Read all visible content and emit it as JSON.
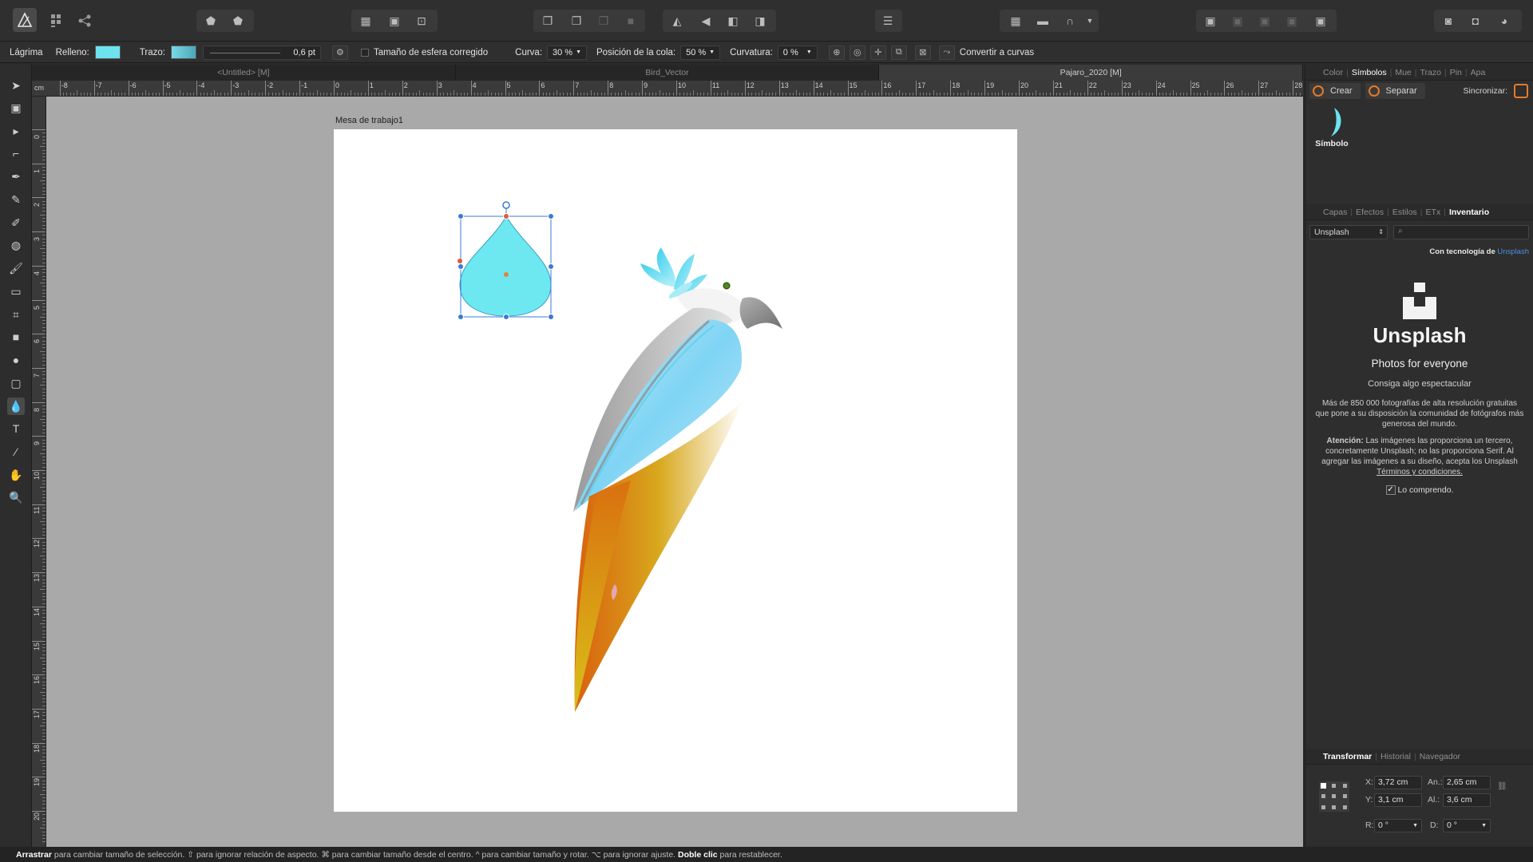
{
  "context_toolbar": {
    "tool_name": "Lágrima",
    "fill_label": "Relleno:",
    "fill_color": "#6de3f0",
    "stroke_label": "Trazo:",
    "stroke_width": "0,6 pt",
    "corrected_size_label": "Tamaño de esfera corregido",
    "curve_label": "Curva:",
    "curve_value": "30 %",
    "tail_label": "Posición de la cola:",
    "tail_value": "50 %",
    "curvature_label": "Curvatura:",
    "curvature_value": "0 %",
    "convert_label": "Convertir a curvas"
  },
  "document_tabs": [
    {
      "label": "<Untitled> [M]",
      "active": false
    },
    {
      "label": "Bird_Vector",
      "active": false
    },
    {
      "label": "Pajaro_2020 [M]",
      "active": true
    }
  ],
  "ruler": {
    "unit": "cm",
    "top_ticks": [
      "-8",
      "-7",
      "-6",
      "-5",
      "-4",
      "-3",
      "-2",
      "-1",
      "0",
      "1",
      "2",
      "3",
      "4",
      "5",
      "6",
      "7",
      "8",
      "9",
      "10",
      "11",
      "12",
      "13",
      "14",
      "15",
      "16",
      "17",
      "18",
      "19",
      "20",
      "21",
      "22",
      "23",
      "24",
      "25",
      "26",
      "27",
      "28"
    ],
    "left_ticks": [
      "0",
      "1",
      "2",
      "3",
      "4",
      "5",
      "6",
      "7",
      "8",
      "9",
      "10",
      "11",
      "12",
      "13",
      "14",
      "15",
      "16",
      "17",
      "18",
      "19",
      "20"
    ]
  },
  "artboard": {
    "label": "Mesa de trabajo1"
  },
  "panel_top": {
    "tabs": [
      "Color",
      "Símbolos",
      "Mue",
      "Trazo",
      "Pin",
      "Apa"
    ],
    "active_tab": "Símbolos",
    "create_label": "Crear",
    "detach_label": "Separar",
    "sync_label": "Sincronizar:",
    "symbol_name": "Símbolo"
  },
  "panel_mid": {
    "tabs": [
      "Capas",
      "Efectos",
      "Estilos",
      "ETx",
      "Inventario"
    ],
    "active_tab": "Inventario",
    "source": "Unsplash",
    "powered_by": "Con tecnología de",
    "powered_link": "Unsplash",
    "brand": "Unsplash",
    "tagline": "Photos for everyone",
    "subtitle": "Consiga algo espectacular",
    "description": "Más de 850 000 fotografías de alta resolución gratuitas que pone a su disposición la comunidad de fotógrafos más generosa del mundo.",
    "attention_bold": "Atención:",
    "attention_text": "Las imágenes las proporciona un tercero, concretamente Unsplash; no las proporciona Serif. Al agregar las imágenes a su diseño, acepta los Unsplash",
    "terms_link": "Términos y condiciones.",
    "agree_label": "Lo comprendo."
  },
  "panel_bottom": {
    "tabs": [
      "Transformar",
      "Historial",
      "Navegador"
    ],
    "active_tab": "Transformar",
    "x_label": "X:",
    "x_value": "3,72 cm",
    "w_label": "An.:",
    "w_value": "2,65 cm",
    "y_label": "Y:",
    "y_value": "3,1 cm",
    "h_label": "Al.:",
    "h_value": "3,6 cm",
    "r_label": "R:",
    "r_value": "0 °",
    "s_label": "D:",
    "s_value": "0 °"
  },
  "status": {
    "s1": "Arrastrar",
    "s2": " para cambiar tamaño de selección. ",
    "s3": "⇧",
    "s4": " para ignorar relación de aspecto. ",
    "s5": "⌘",
    "s6": " para cambiar tamaño desde el centro. ",
    "s7": "^",
    "s8": " para cambiar tamaño y rotar. ",
    "s9": "⌥",
    "s10": " para ignorar ajuste. ",
    "s11": "Doble clic",
    "s12": " para restablecer."
  }
}
